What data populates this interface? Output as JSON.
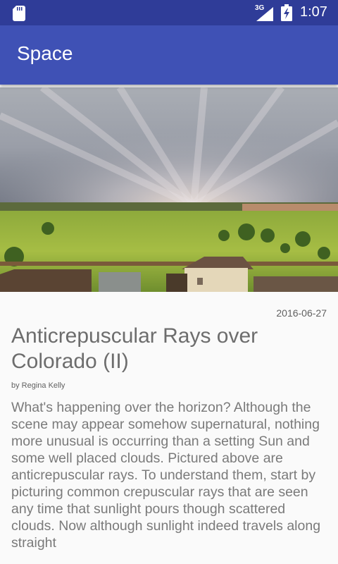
{
  "status_bar": {
    "network_type": "3G",
    "time": "1:07",
    "icons": [
      "sd-card-icon",
      "signal-icon",
      "battery-icon"
    ]
  },
  "app_bar": {
    "title": "Space"
  },
  "article": {
    "image_icon": "photo",
    "date": "2016-06-27",
    "title": "Anticrepuscular Rays over Colorado (II)",
    "byline": "by Regina Kelly",
    "body": "What's happening over the horizon?  Although the scene may appear somehow supernatural, nothing more unusual is occurring than a setting Sun and some well placed clouds.  Pictured above are anticrepuscular rays.  To understand them, start by picturing common crepuscular rays that are seen any time that sunlight pours though scattered clouds. Now although sunlight indeed travels along straight"
  },
  "colors": {
    "status_bar": "#2f3c98",
    "app_bar": "#3f51b5",
    "background": "#fafafa",
    "text": "#757575"
  }
}
